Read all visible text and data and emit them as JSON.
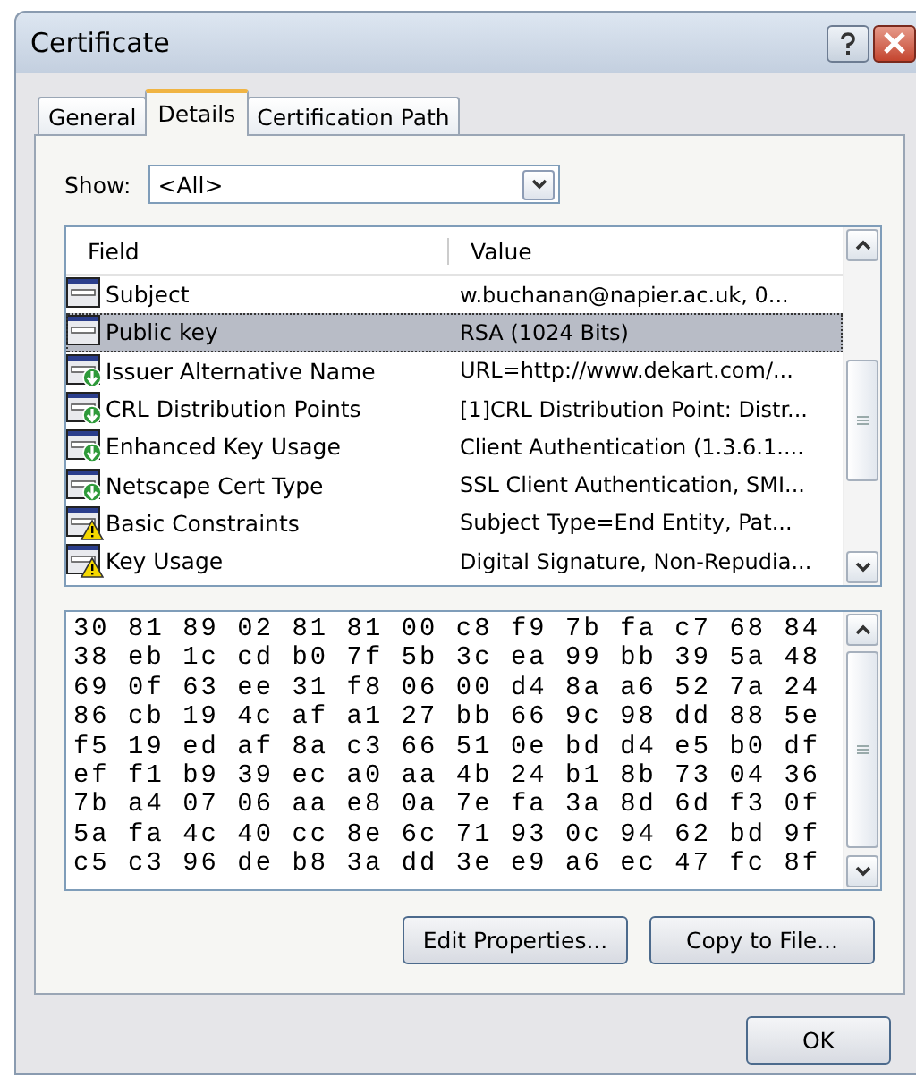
{
  "window": {
    "title": "Certificate"
  },
  "tabs": [
    {
      "label": "General",
      "selected": false
    },
    {
      "label": "Details",
      "selected": true
    },
    {
      "label": "Certification Path",
      "selected": false
    }
  ],
  "show": {
    "label": "Show:",
    "value": "<All>"
  },
  "table": {
    "columns": [
      "Field",
      "Value"
    ],
    "rows": [
      {
        "field": "Subject",
        "value": "w.buchanan@napier.ac.uk, 0...",
        "kind": "plain",
        "selected": false
      },
      {
        "field": "Public key",
        "value": "RSA (1024 Bits)",
        "kind": "plain",
        "selected": true
      },
      {
        "field": "Issuer Alternative Name",
        "value": "URL=http://www.dekart.com/...",
        "kind": "extension",
        "selected": false
      },
      {
        "field": "CRL Distribution Points",
        "value": "[1]CRL Distribution Point: Distr...",
        "kind": "extension",
        "selected": false
      },
      {
        "field": "Enhanced Key Usage",
        "value": "Client Authentication (1.3.6.1....",
        "kind": "extension",
        "selected": false
      },
      {
        "field": "Netscape Cert Type",
        "value": "SSL Client Authentication, SMI...",
        "kind": "extension",
        "selected": false
      },
      {
        "field": "Basic Constraints",
        "value": "Subject Type=End Entity, Pat...",
        "kind": "critical",
        "selected": false
      },
      {
        "field": "Key Usage",
        "value": "Digital Signature, Non-Repudia...",
        "kind": "critical",
        "selected": false
      }
    ]
  },
  "hex_lines": [
    "30 81 89 02 81 81 00 c8 f9 7b fa c7 68 84",
    "38 eb 1c cd b0 7f 5b 3c ea 99 bb 39 5a 48",
    "69 0f 63 ee 31 f8 06 00 d4 8a a6 52 7a 24",
    "86 cb 19 4c af a1 27 bb 66 9c 98 dd 88 5e",
    "f5 19 ed af 8a c3 66 51 0e bd d4 e5 b0 df",
    "ef f1 b9 39 ec a0 aa 4b 24 b1 8b 73 04 36",
    "7b a4 07 06 aa e8 0a 7e fa 3a 8d 6d f3 0f",
    "5a fa 4c 40 cc 8e 6c 71 93 0c 94 62 bd 9f",
    "c5 c3 96 de b8 3a dd 3e e9 a6 ec 47 fc 8f"
  ],
  "buttons": [
    "Edit Properties...",
    "Copy to File..."
  ],
  "footer_buttons": [
    "OK"
  ]
}
